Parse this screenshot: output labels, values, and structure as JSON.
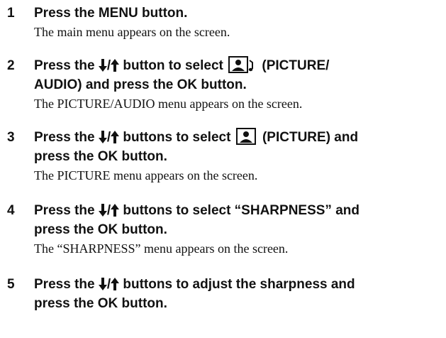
{
  "steps": [
    {
      "number": "1",
      "instruction": "Press the MENU button.",
      "result": "The main menu appears on the screen."
    },
    {
      "number": "2",
      "instruction_prefix": "Press the",
      "instruction_mid": "button to select",
      "instruction_suffix": "(PICTURE/",
      "instruction_line2": "AUDIO) and press the OK button.",
      "result": "The PICTURE/AUDIO menu appears on the screen.",
      "icons": [
        "down-arrow-icon",
        "up-arrow-icon",
        "picture-audio-icon"
      ]
    },
    {
      "number": "3",
      "instruction_prefix": "Press the",
      "instruction_mid": "buttons to select",
      "instruction_suffix": "(PICTURE) and",
      "instruction_line2": "press the OK button.",
      "result": "The PICTURE menu appears on the screen.",
      "icons": [
        "down-arrow-icon",
        "up-arrow-icon",
        "picture-icon"
      ]
    },
    {
      "number": "4",
      "instruction_prefix": "Press the",
      "instruction_suffix": "buttons to select “SHARPNESS” and",
      "instruction_line2": "press the OK button.",
      "result": "The “SHARPNESS” menu appears on the screen.",
      "icons": [
        "down-arrow-icon",
        "up-arrow-icon"
      ]
    },
    {
      "number": "5",
      "instruction_prefix": "Press the",
      "instruction_suffix": "buttons to adjust the sharpness and",
      "instruction_line2": "press the OK button.",
      "icons": [
        "down-arrow-icon",
        "up-arrow-icon"
      ]
    }
  ],
  "symbols": {
    "slash": "/"
  }
}
